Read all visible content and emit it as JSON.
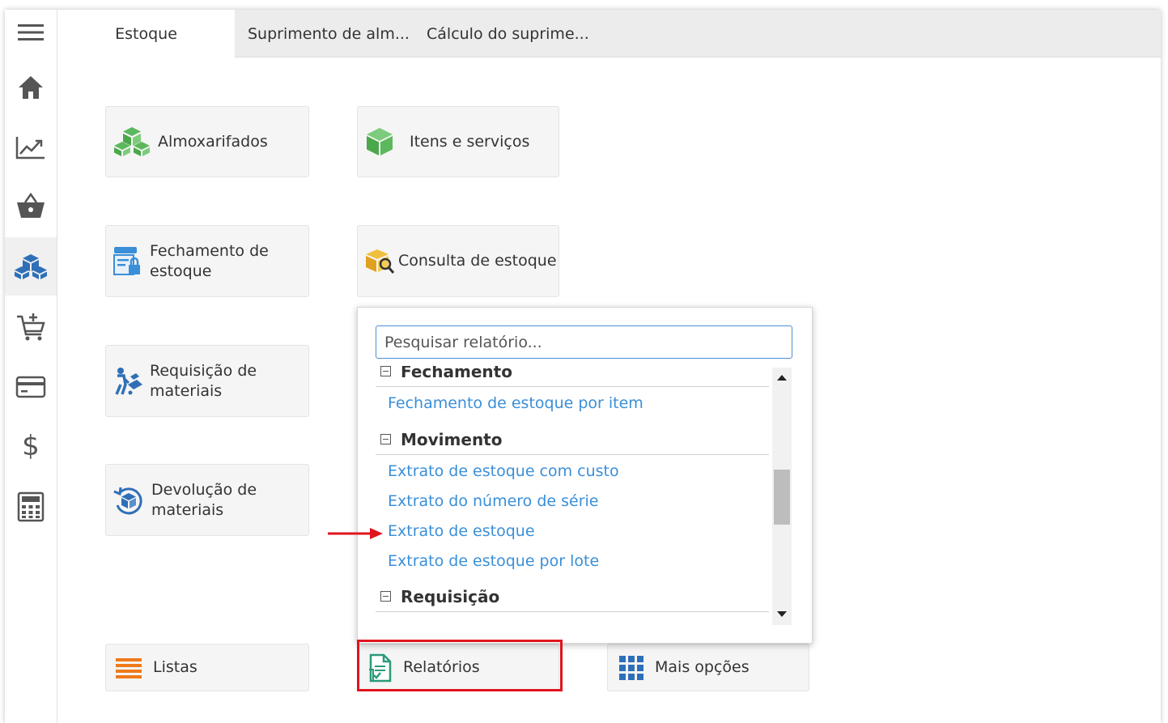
{
  "tabs": [
    {
      "label": "Estoque",
      "active": true
    },
    {
      "label": "Suprimento de alm..."
    },
    {
      "label": "Cálculo do suprime..."
    }
  ],
  "sidebar": {
    "items": [
      {
        "icon": "menu-icon"
      },
      {
        "icon": "home-icon"
      },
      {
        "icon": "chart-icon"
      },
      {
        "icon": "basket-icon"
      },
      {
        "icon": "boxes-icon",
        "active": true
      },
      {
        "icon": "cart-add-icon"
      },
      {
        "icon": "card-icon"
      },
      {
        "icon": "dollar-icon"
      },
      {
        "icon": "calculator-icon"
      }
    ]
  },
  "tiles": {
    "almoxarifados": "Almoxarifados",
    "itens": "Itens e serviços",
    "fechamento_l1": "Fechamento de",
    "fechamento_l2": "estoque",
    "consulta": "Consulta de estoque",
    "requisicao_l1": "Requisição de",
    "requisicao_l2": "materiais",
    "devolucao_l1": "Devolução de",
    "devolucao_l2": "materiais",
    "listas": "Listas",
    "relatorios": "Relatórios",
    "mais": "Mais opções"
  },
  "reports": {
    "search_placeholder": "Pesquisar relatório...",
    "groups": [
      {
        "name": "Fechamento",
        "items": [
          "Fechamento de estoque por item"
        ]
      },
      {
        "name": "Movimento",
        "items": [
          "Extrato de estoque com custo",
          "Extrato do número de série",
          "Extrato de estoque",
          "Extrato de estoque por lote"
        ]
      },
      {
        "name": "Requisição",
        "items": []
      }
    ]
  },
  "colors": {
    "accent_green": "#5cb85c",
    "link_blue": "#3a8fd8",
    "sidebar_icon": "#555555",
    "active_blue": "#2f6fb8",
    "highlight_red": "#e0141e",
    "orange": "#f07a1a"
  }
}
